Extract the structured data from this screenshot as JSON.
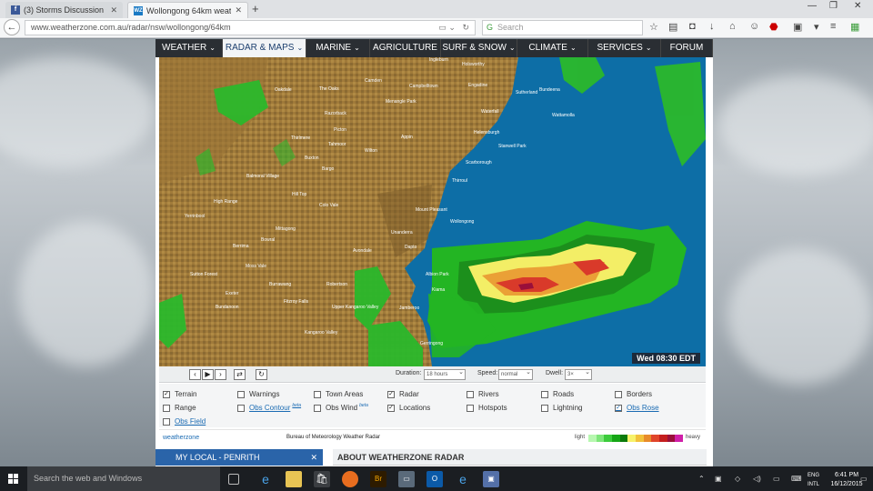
{
  "browser": {
    "tabs": [
      {
        "icon": "f",
        "title": "(3) Storms Discussion Gro..."
      },
      {
        "icon": "WZ",
        "title": "Wollongong 64km weath..."
      }
    ],
    "url": "www.weatherzone.com.au/radar/nsw/wollongong/64km",
    "search_placeholder": "Search"
  },
  "site": {
    "menu": [
      {
        "label": "WEATHER",
        "dropdown": true
      },
      {
        "label": "RADAR & MAPS",
        "dropdown": true,
        "active": true
      },
      {
        "label": "MARINE",
        "dropdown": true
      },
      {
        "label": "AGRICULTURE",
        "dropdown": false
      },
      {
        "label": "SURF & SNOW",
        "dropdown": true
      },
      {
        "label": "CLIMATE",
        "dropdown": true
      },
      {
        "label": "SERVICES",
        "dropdown": true
      },
      {
        "label": "FORUM",
        "dropdown": false
      }
    ],
    "radar": {
      "timestamp": "Wed 08:30 EDT",
      "places": [
        "Colo Vale",
        "Mittagong",
        "Bowral",
        "Moss Vale",
        "Berrima",
        "Exeter",
        "Bundanoon",
        "Robertson",
        "Fitzroy Falls",
        "Kangaroo Valley",
        "Picton",
        "Tahmoor",
        "Bargo",
        "Thirlmere",
        "Buxton",
        "Razorback",
        "The Oaks",
        "Camden",
        "Campbelltown",
        "Menangle Park",
        "Appin",
        "Wilton",
        "Helensburgh",
        "Stanwell Park",
        "Scarborough",
        "Thirroul",
        "Wollongong",
        "Dapto",
        "Unanderra",
        "Albion Park",
        "Kiama",
        "Gerringong",
        "Jamberoo",
        "Sutherland",
        "Bundeena",
        "Engadine",
        "Waterfall",
        "Oakdale",
        "Hill Top",
        "High Range",
        "Balmoral Village",
        "Yerrinbool",
        "Sutton Forest",
        "Burrawang",
        "Upper Kangaroo Valley",
        "Avondale",
        "Wattamolla",
        "Mount Pleasant",
        "Ingleburn",
        "Holsworthy",
        "Helensburgh"
      ],
      "controls": {
        "duration_label": "Duration:",
        "duration_value": "18 hours",
        "speed_label": "Speed:",
        "speed_value": "normal",
        "dwell_label": "Dwell:",
        "dwell_value": "3×"
      }
    },
    "layers": [
      {
        "label": "Terrain",
        "checked": true,
        "link": false
      },
      {
        "label": "Warnings",
        "checked": false,
        "link": false
      },
      {
        "label": "Town Areas",
        "checked": false,
        "link": false
      },
      {
        "label": "Radar",
        "checked": true,
        "link": false
      },
      {
        "label": "Rivers",
        "checked": false,
        "link": false
      },
      {
        "label": "Roads",
        "checked": false,
        "link": false
      },
      {
        "label": "Borders",
        "checked": false,
        "link": false
      },
      {
        "label": "Range",
        "checked": false,
        "link": false
      },
      {
        "label": "Obs Contour",
        "checked": false,
        "link": true,
        "beta": "beta"
      },
      {
        "label": "Obs Wind",
        "checked": false,
        "link": false,
        "beta": "beta"
      },
      {
        "label": "Locations",
        "checked": true,
        "link": false
      },
      {
        "label": "Hotspots",
        "checked": false,
        "link": false
      },
      {
        "label": "Lightning",
        "checked": false,
        "link": false
      },
      {
        "label": "Obs Rose",
        "checked": true,
        "link": true
      },
      {
        "label": "Obs Field",
        "checked": false,
        "link": true
      }
    ],
    "credit": {
      "brand": "weatherzone",
      "source": "Bureau of Meteorology Weather Radar",
      "legend_low": "light",
      "legend_high": "heavy",
      "scale_colors": [
        "#b7f7b0",
        "#7ee67a",
        "#3ccb3c",
        "#16a616",
        "#0b7a0b",
        "#f7f26a",
        "#f2c13a",
        "#e88b2a",
        "#e0452a",
        "#c41e1e",
        "#9a0f3a",
        "#d01fa8"
      ]
    },
    "sidebar": {
      "my_local": "MY LOCAL - PENRITH",
      "my_local_icon": "close"
    },
    "about_title": "ABOUT WEATHERZONE RADAR"
  },
  "taskbar": {
    "search_placeholder": "Search the web and Windows",
    "language": "ENG",
    "layout": "INTL",
    "time": "6:41 PM",
    "date": "16/12/2015"
  },
  "colors": {
    "menu_bg": "#2a2e33",
    "accent": "#2a64a9",
    "ocean": "#0d6ea6"
  }
}
